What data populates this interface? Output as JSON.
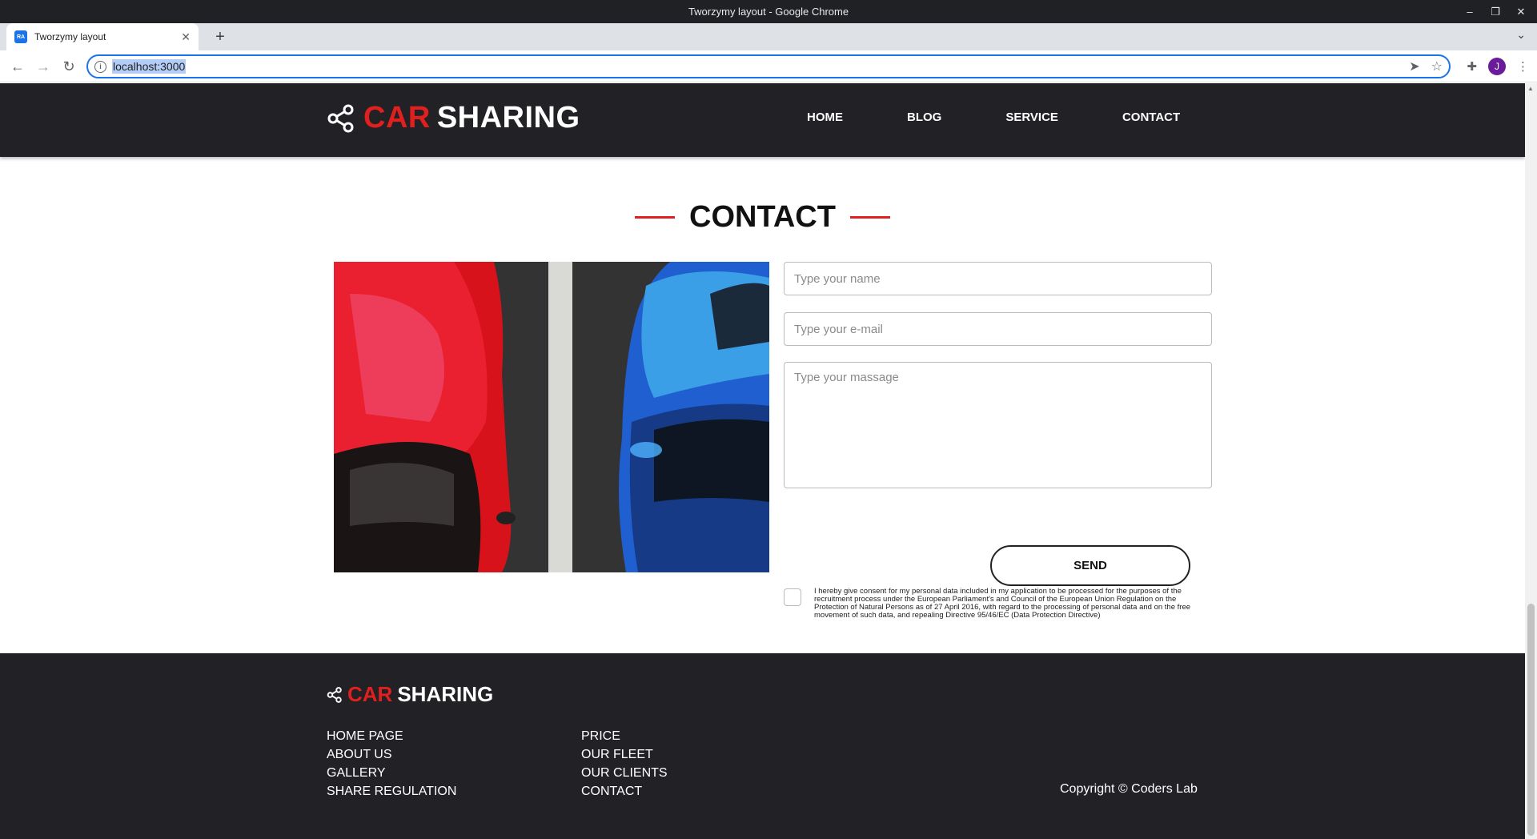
{
  "window": {
    "title": "Tworzymy layout - Google Chrome"
  },
  "tab": {
    "favicon": "RA",
    "label": "Tworzymy layout",
    "close": "✕",
    "new_tab": "+"
  },
  "toolbar": {
    "url": "localhost:3000",
    "profile_initial": "J"
  },
  "site": {
    "logo_car": "CAR",
    "logo_sharing": "SHARING",
    "nav": [
      "HOME",
      "BLOG",
      "SERVICE",
      "CONTACT"
    ]
  },
  "contact": {
    "title": "CONTACT",
    "name_placeholder": "Type your name",
    "email_placeholder": "Type your e-mail",
    "message_placeholder": "Type your massage",
    "consent": "I hereby give consent for my personal data included in my application to be processed for the purposes of the recruitment process under the European Parliament's and Council of the European Union Regulation on the Protection of Natural Persons as of 27 April 2016, with regard to the processing of personal data and on the free movement of such data, and repealing Directive 95/46/EC (Data Protection Directive)",
    "send_label": "SEND"
  },
  "footer": {
    "logo_car": "CAR",
    "logo_sharing": "SHARING",
    "col1": [
      "HOME PAGE",
      "ABOUT US",
      "GALLERY",
      "SHARE REGULATION"
    ],
    "col2": [
      "PRICE",
      "OUR FLEET",
      "OUR CLIENTS",
      "CONTACT"
    ],
    "copyright": "Copyright © Coders Lab"
  },
  "colors": {
    "accent": "#e01f1f",
    "dark": "#222125",
    "focus": "#1a73e8"
  }
}
